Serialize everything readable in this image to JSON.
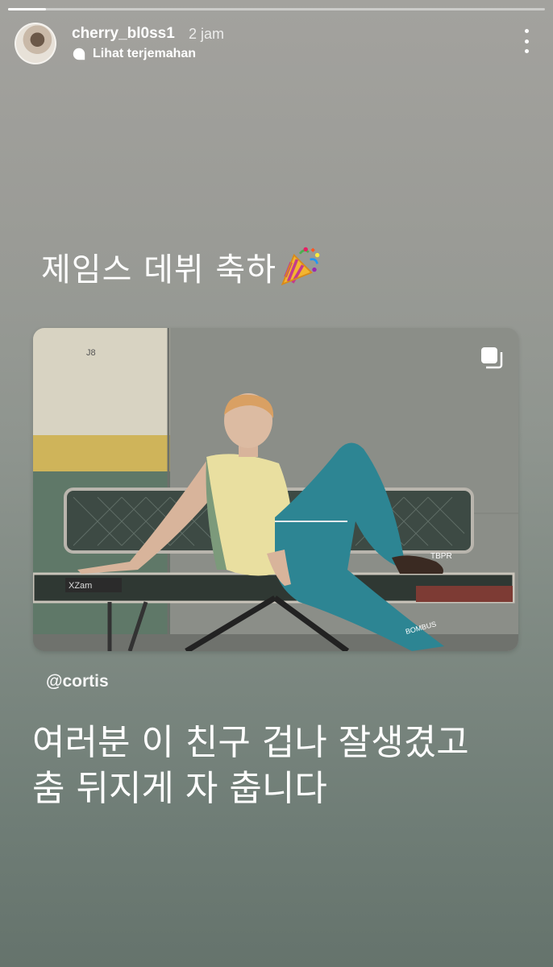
{
  "story": {
    "progress": 0.07,
    "username": "cherry_bl0ss1",
    "time": "2 jam",
    "translate_label": "Lihat terjemahan",
    "caption_top": "제임스 데뷔 축하",
    "caption_top_sticker": "party-popper-icon",
    "mention": "@cortis",
    "caption_bottom_line1": "여러분 이 친구 겁나 잘생겼고",
    "caption_bottom_line2": "춤 뒤지게 자 춥니다"
  },
  "post": {
    "bench_sticker_1": "TBPR",
    "bench_sticker_2": "XZam",
    "bench_sticker_3": "BOMBUS",
    "wall_text": "J8",
    "multi_image_icon": "multiple-images-icon"
  },
  "icons": {
    "more": "more-vertical-icon",
    "translate": "translate-icon"
  }
}
